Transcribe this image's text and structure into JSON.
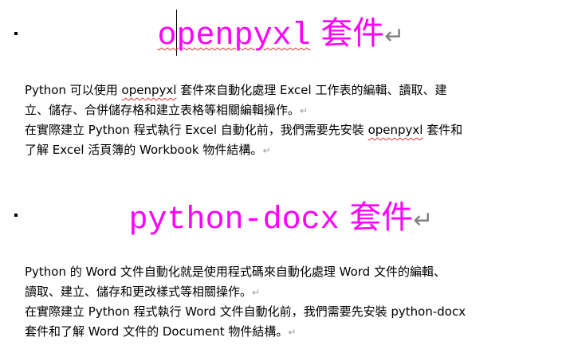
{
  "section1": {
    "heading_en": "openpyxl",
    "heading_zh": " 套件",
    "paragraph_mark": "↵",
    "lines": [
      {
        "pre": "Python 可以使用 ",
        "sq": "openpyxl",
        "post": " 套件來自動化處理 Excel 工作表的編輯、讀取、建"
      },
      {
        "pre": "立、儲存、合併儲存格和建立表格等相關編輯操作。",
        "sq": "",
        "post": ""
      },
      {
        "pre": "在實際建立 Python 程式執行 Excel 自動化前，我們需要先安裝 ",
        "sq": "openpyxl",
        "post": " 套件和"
      },
      {
        "pre": "了解 Excel 活頁簿的 Workbook 物件結構。",
        "sq": "",
        "post": ""
      }
    ]
  },
  "section2": {
    "heading_en": "python-docx",
    "heading_zh": " 套件",
    "paragraph_mark": "↵",
    "lines": [
      {
        "pre": "Python 的 Word 文件自動化就是使用程式碼來自動化處理 Word 文件的編輯、",
        "sq": "",
        "post": ""
      },
      {
        "pre": "讀取、建立、儲存和更改樣式等相關操作。",
        "sq": "",
        "post": ""
      },
      {
        "pre": "在實際建立 Python 程式執行 Word 文件自動化前，我們需要先安裝 python-docx",
        "sq": "",
        "post": ""
      },
      {
        "pre": "套件和了解 Word 文件的 Document 物件結構。",
        "sq": "",
        "post": ""
      }
    ]
  },
  "marks": {
    "heading_mark": "↵",
    "line_mark": "↵"
  },
  "colors": {
    "heading": "#ff00ff",
    "spell_underline": "#e03030",
    "formatting_mark": "#808080"
  }
}
